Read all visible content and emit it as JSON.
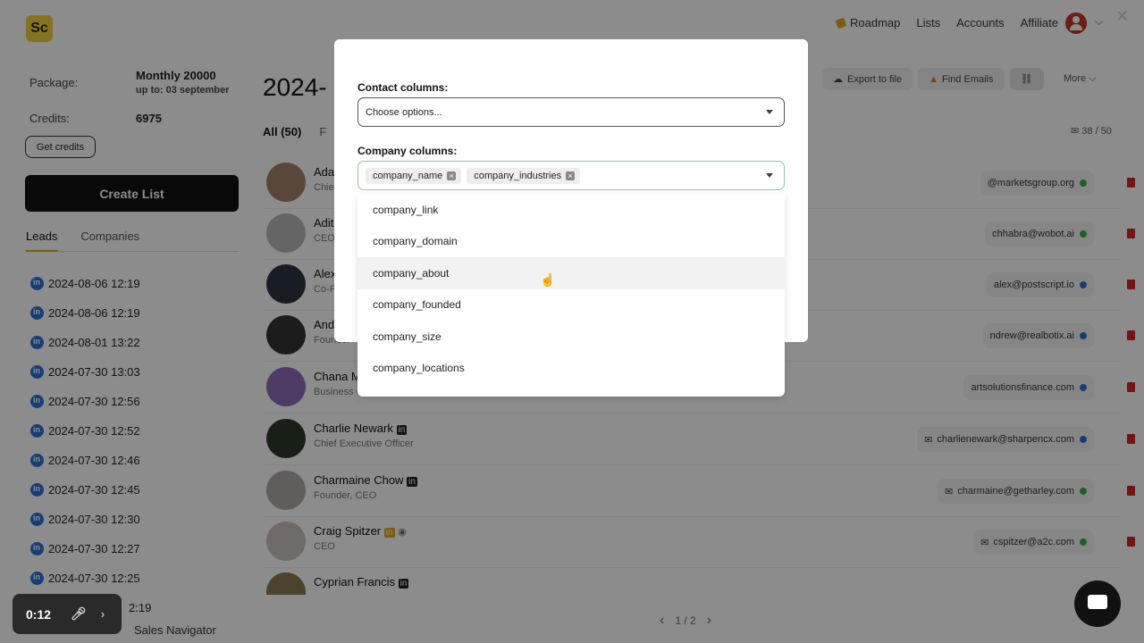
{
  "topbar": {
    "logo": "Sc",
    "nav": [
      "Roadmap",
      "Lists",
      "Accounts",
      "Affiliate"
    ]
  },
  "sidebar": {
    "package_label": "Package:",
    "package_value": "Monthly 20000",
    "package_sub": "up to: 03 september",
    "credits_label": "Credits:",
    "credits_value": "6975",
    "get_credits": "Get credits",
    "create_list": "Create List",
    "tabs": [
      "Leads",
      "Companies"
    ],
    "items": [
      "2024-08-06 12:19",
      "2024-08-06 12:19",
      "2024-08-01 13:22",
      "2024-07-30 13:03",
      "2024-07-30 12:56",
      "2024-07-30 12:52",
      "2024-07-30 12:46",
      "2024-07-30 12:45",
      "2024-07-30 12:30",
      "2024-07-30 12:27",
      "2024-07-30 12:25",
      "2:19"
    ],
    "footer": "Sales Navigator"
  },
  "main": {
    "title": "2024-",
    "tabs": [
      "All (50)",
      "F"
    ],
    "toolbar": {
      "export": "Export to file",
      "find_emails": "Find Emails",
      "more": "More"
    },
    "count": "38 / 50",
    "rows": [
      {
        "name": "Ada",
        "role": "Chie",
        "email": "@marketsgroup.org",
        "status": "green"
      },
      {
        "name": "Adit",
        "role": "CEO",
        "email": "chhabra@wobot.ai",
        "status": "green"
      },
      {
        "name": "Alex",
        "role": "Co-F",
        "email": "alex@postscript.io",
        "status": "blue"
      },
      {
        "name": "And",
        "role": "Founder",
        "email": "ndrew@realbotix.ai",
        "status": "blue"
      },
      {
        "name": "Chana M",
        "role": "Business Owner",
        "email": "artsolutionsfinance.com",
        "status": "blue"
      },
      {
        "name": "Charlie Newark",
        "role": "Chief Executive Officer",
        "email": "charlienewark@sharpencx.com",
        "status": "blue"
      },
      {
        "name": "Charmaine Chow",
        "role": "Founder, CEO",
        "email": "charmaine@getharley.com",
        "status": "green"
      },
      {
        "name": "Craig Spitzer",
        "role": "CEO",
        "email": "cspitzer@a2c.com",
        "status": "green"
      },
      {
        "name": "Cyprian Francis",
        "role": "",
        "email": "",
        "status": ""
      }
    ],
    "pager": "1 / 2"
  },
  "modal": {
    "contact_label": "Contact columns:",
    "contact_placeholder": "Choose options...",
    "company_label": "Company columns:",
    "company_chips": [
      "company_name",
      "company_industries"
    ],
    "options": [
      "company_link",
      "company_domain",
      "company_about",
      "company_founded",
      "company_size",
      "company_locations"
    ],
    "hovered_option": "company_about"
  },
  "video": {
    "time": "0:12"
  }
}
